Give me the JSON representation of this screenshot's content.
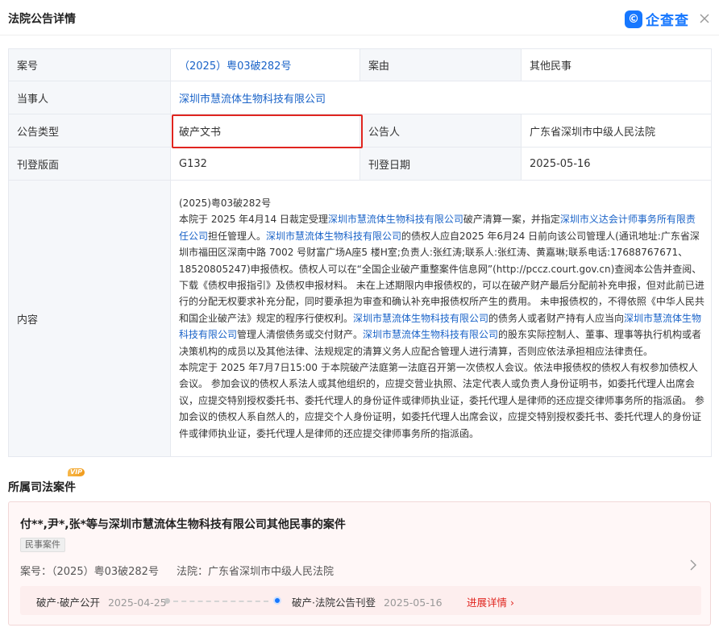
{
  "header": {
    "title": "法院公告详情",
    "logo_mark": "©",
    "logo_text": "企查查"
  },
  "detail": {
    "case_no_label": "案号",
    "case_no_value": "（2025）粤03破282号",
    "cause_label": "案由",
    "cause_value": "其他民事",
    "party_label": "当事人",
    "party_value": "深圳市慧流体生物科技有限公司",
    "type_label": "公告类型",
    "type_value": "破产文书",
    "announcer_label": "公告人",
    "announcer_value": "广东省深圳市中级人民法院",
    "page_label": "刊登版面",
    "page_value": "G132",
    "date_label": "刊登日期",
    "date_value": "2025-05-16",
    "content_label": "内容",
    "content": {
      "heading": "(2025)粤03破282号",
      "p1_a": "本院于 2025 年4月14 日裁定受理",
      "p1_link1": "深圳市慧流体生物科技有限公司",
      "p1_b": "破产清算一案，并指定",
      "p1_link2": "深圳市义达会计师事务所有限责任公司",
      "p1_c": "担任管理人。",
      "p1_link3": "深圳市慧流体生物科技有限公司",
      "p1_d": "的债权人应自2025 年6月24 日前向该公司管理人(通讯地址:广东省深圳市福田区深南中路 7002 号财富广场A座5 楼H室;负责人:张红涛;联系人:张红涛、黄嘉琳;联系电话:17688767671、18520805247)申报债权。债权人可以在“全国企业破产重整案件信息网”(http://pccz.court.gov.cn)查阅本公告并查阅、下载《债权申报指引》及债权申报材料。 未在上述期限内申报债权的，可以在破产财产最后分配前补充申报，但对此前已进行的分配无权要求补充分配，同时要承担为审查和确认补充申报债权所产生的费用。 未申报债权的，不得依照《中华人民共和国企业破产法》规定的程序行使权利。",
      "p1_link4": "深圳市慧流体生物科技有限公司",
      "p1_e": "的债务人或者财产持有人应当向",
      "p1_link5": "深圳市慧流体生物科技有限公司",
      "p1_f": "管理人清偿债务或交付财产。",
      "p1_link6": "深圳市慧流体生物科技有限公司",
      "p1_g": "的股东实际控制人、董事、理事等执行机构或者决策机构的成员以及其他法律、法规规定的清算义务人应配合管理人进行清算，否则应依法承担相应法律责任。",
      "p2": "本院定于 2025 年7月7日15:00 于本院破产法庭第一法庭召开第一次债权人会议。依法申报债权的债权人有权参加债权人会议。 参加会议的债权人系法人或其他组织的，应提交营业执照、法定代表人或负责人身份证明书，如委托代理人出席会议，应提交特别授权委托书、委托代理人的身份证件或律师执业证，委托代理人是律师的还应提交律师事务所的指派函。 参加会议的债权人系自然人的，应提交个人身份证明，如委托代理人出席会议，应提交特别授权委托书、委托代理人的身份证件或律师执业证，委托代理人是律师的还应提交律师事务所的指派函。"
    }
  },
  "section": {
    "title": "所属司法案件",
    "vip": "VIP"
  },
  "case_card": {
    "title": "付**,尹*,张*等与深圳市慧流体生物科技有限公司其他民事的案件",
    "tag": "民事案件",
    "case_no_label": "案号：",
    "case_no_value": "（2025）粤03破282号",
    "court_label": "法院：",
    "court_value": "广东省深圳市中级人民法院",
    "timeline": [
      {
        "label": "破产·破产公开",
        "date": "2025-04-25"
      },
      {
        "label": "破产·法院公告刊登",
        "date": "2025-05-16"
      }
    ],
    "progress_link": "进展详情"
  },
  "colors": {
    "link": "#1a63c8",
    "brand": "#1677ff",
    "highlight": "#e0251f"
  }
}
